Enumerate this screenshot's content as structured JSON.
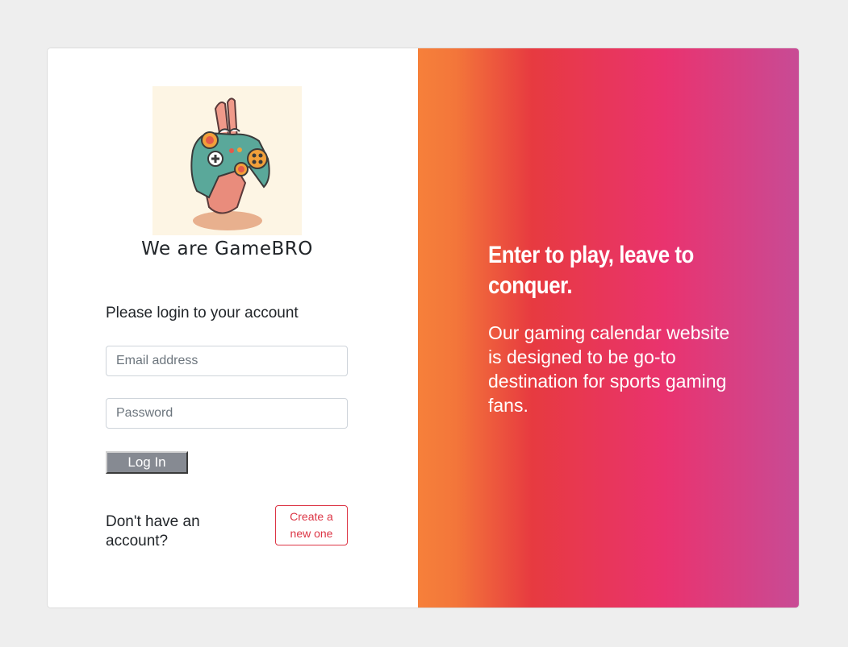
{
  "brand": {
    "name": "We are GameBRO",
    "logo_icon": "gamepad-hand-icon"
  },
  "login": {
    "prompt": "Please login to your account",
    "email_placeholder": "Email address",
    "password_placeholder": "Password",
    "login_label": "Log In"
  },
  "signup": {
    "question": "Don't have an account?",
    "button_label": "Create a new one"
  },
  "hero": {
    "headline": "Enter to play, leave to conquer.",
    "tagline": "Our gaming calendar website is designed to be go-to destination for sports gaming fans."
  },
  "colors": {
    "page_background": "#eeeeee",
    "accent_red": "#dc3545",
    "gradient": [
      "#f6803a",
      "#e73a40",
      "#e9336f",
      "#c84b95"
    ]
  }
}
